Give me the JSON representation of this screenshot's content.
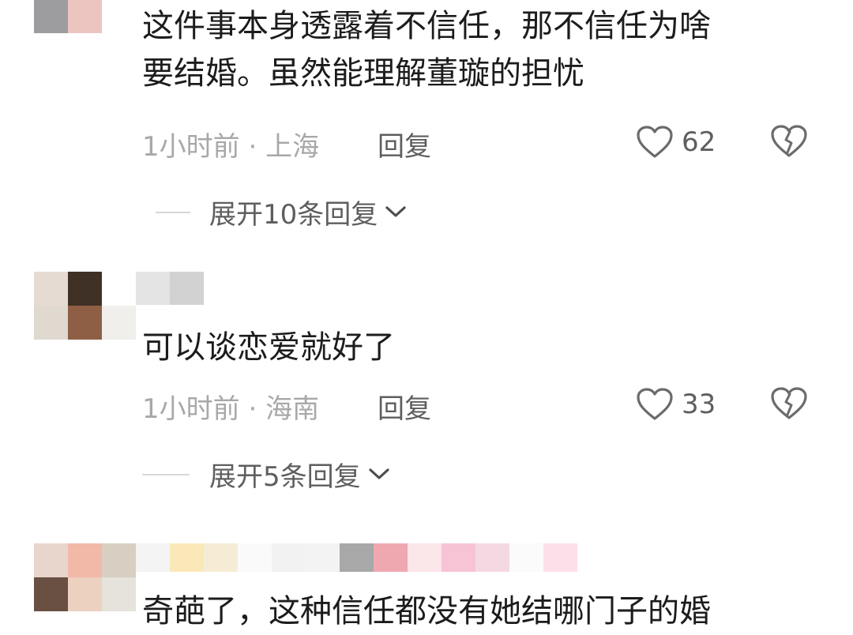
{
  "comments": [
    {
      "text_lines": [
        "这件事本身透露着不信任，那不信任为啥",
        "要结婚。虽然能理解董璇的担忧"
      ],
      "time": "1小时前",
      "location": "· 上海",
      "reply_label": "回复",
      "likes": "62",
      "expand_label": "展开10条回复"
    },
    {
      "text_lines": [
        "可以谈恋爱就好了"
      ],
      "time": "1小时前",
      "location": "· 海南",
      "reply_label": "回复",
      "likes": "33",
      "expand_label": "展开5条回复"
    },
    {
      "text_lines": [
        "奇葩了，这种信任都没有她结哪门子的婚"
      ]
    }
  ],
  "icons": {
    "like": "heart-outline-icon",
    "dislike": "broken-heart-icon",
    "expand": "chevron-down-icon"
  },
  "colors": {
    "text": "#1c1c1c",
    "meta": "#a8a8a8",
    "action": "#5e5e5e"
  }
}
